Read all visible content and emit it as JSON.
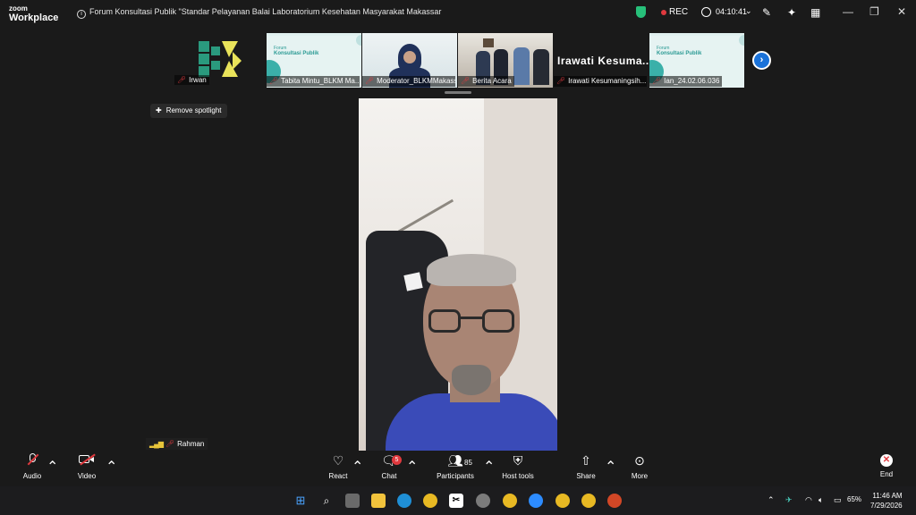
{
  "app": {
    "logo_top": "zoom",
    "logo_bottom": "Workplace"
  },
  "meeting": {
    "title": "Forum Konsultasi Publik \"Standar Pelayanan Balai Laboratorium Kesehatan Masyarakat Makassar"
  },
  "titlebar": {
    "rec": "REC",
    "timer": "04:10:41",
    "colors": {
      "shield": "#27c07a",
      "rec": "#e0393e"
    }
  },
  "gallery": {
    "first_participant": "Irwan",
    "tiles": [
      {
        "name": "Tabita Mintu_BLKM Ma...",
        "slide_small": "Forum",
        "slide_title": "Konsultasi Publik"
      },
      {
        "name": "Moderator_BLKMMakassar"
      },
      {
        "name": "Berita Acara"
      },
      {
        "name": "Irawati Kesumaningsih...",
        "display": "Irawati  Kesuma..."
      },
      {
        "name": "Ian_24.02.06.036",
        "slide_small": "Forum",
        "slide_title": "Konsultasi Publik"
      }
    ]
  },
  "spotlight": {
    "remove_label": "Remove spotlight",
    "speaker_name": "Rahman"
  },
  "controls": {
    "audio": "Audio",
    "video": "Video",
    "react": "React",
    "chat": "Chat",
    "chat_badge": "5",
    "participants": "Participants",
    "participants_count": "85",
    "host_tools": "Host tools",
    "share": "Share",
    "more": "More",
    "end": "End"
  },
  "taskbar": {
    "battery": "65%",
    "time": "11:46 AM",
    "date": "7/29/2026"
  }
}
